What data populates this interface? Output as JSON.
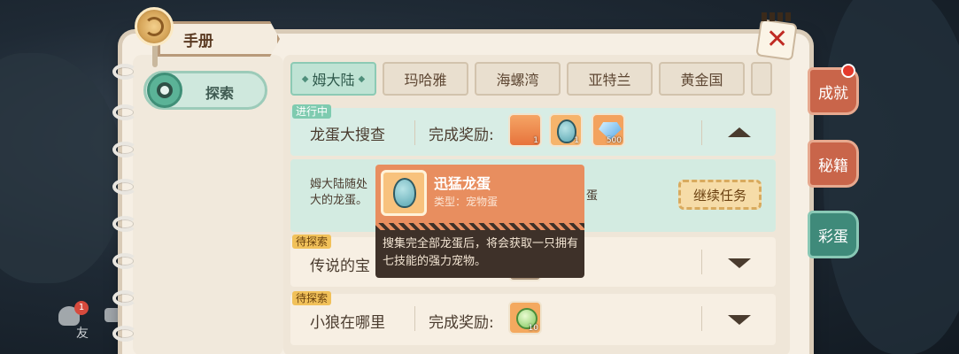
{
  "header": {
    "title": "手册"
  },
  "sidebar": {
    "explore_label": "探索"
  },
  "tabs": [
    {
      "label": "姆大陆",
      "active": true
    },
    {
      "label": "玛哈雅",
      "active": false
    },
    {
      "label": "海螺湾",
      "active": false
    },
    {
      "label": "亚特兰",
      "active": false
    },
    {
      "label": "黄金国",
      "active": false
    }
  ],
  "quests": [
    {
      "status": "进行中",
      "title": "龙蛋大搜查",
      "reward_label": "完成奖励:",
      "rewards": [
        {
          "icon": "orange-card-icon",
          "qty": "1"
        },
        {
          "icon": "egg-icon",
          "qty": "1"
        },
        {
          "icon": "crystal-icon",
          "qty": "500"
        }
      ],
      "expanded": true
    },
    {
      "status": "待探索",
      "title": "传说的宝"
    },
    {
      "status": "待探索",
      "title": "小狼在哪里",
      "reward_label": "完成奖励:",
      "rewards": [
        {
          "icon": "green-orb-icon",
          "qty": "10"
        }
      ]
    }
  ],
  "expanded_detail": {
    "desc_line1": "姆大陆随处",
    "desc_line2": "大的龙蛋。",
    "desc_tail": "蛋",
    "continue_label": "继续任务"
  },
  "tooltip": {
    "name": "迅猛龙蛋",
    "type": "类型：宠物蛋",
    "desc": "搜集完全部龙蛋后，将会获取一只拥有七技能的强力宠物。"
  },
  "side_tabs": [
    {
      "label": "成就",
      "has_notification": true
    },
    {
      "label": "秘籍"
    },
    {
      "label": "彩蛋",
      "active": true
    }
  ],
  "bottom_left": {
    "friend_label": "友",
    "friend_badge": "1"
  },
  "colors": {
    "accent_green": "#3f8a7a",
    "accent_red": "#c9654a",
    "tooltip_orange": "#e88e5f"
  }
}
